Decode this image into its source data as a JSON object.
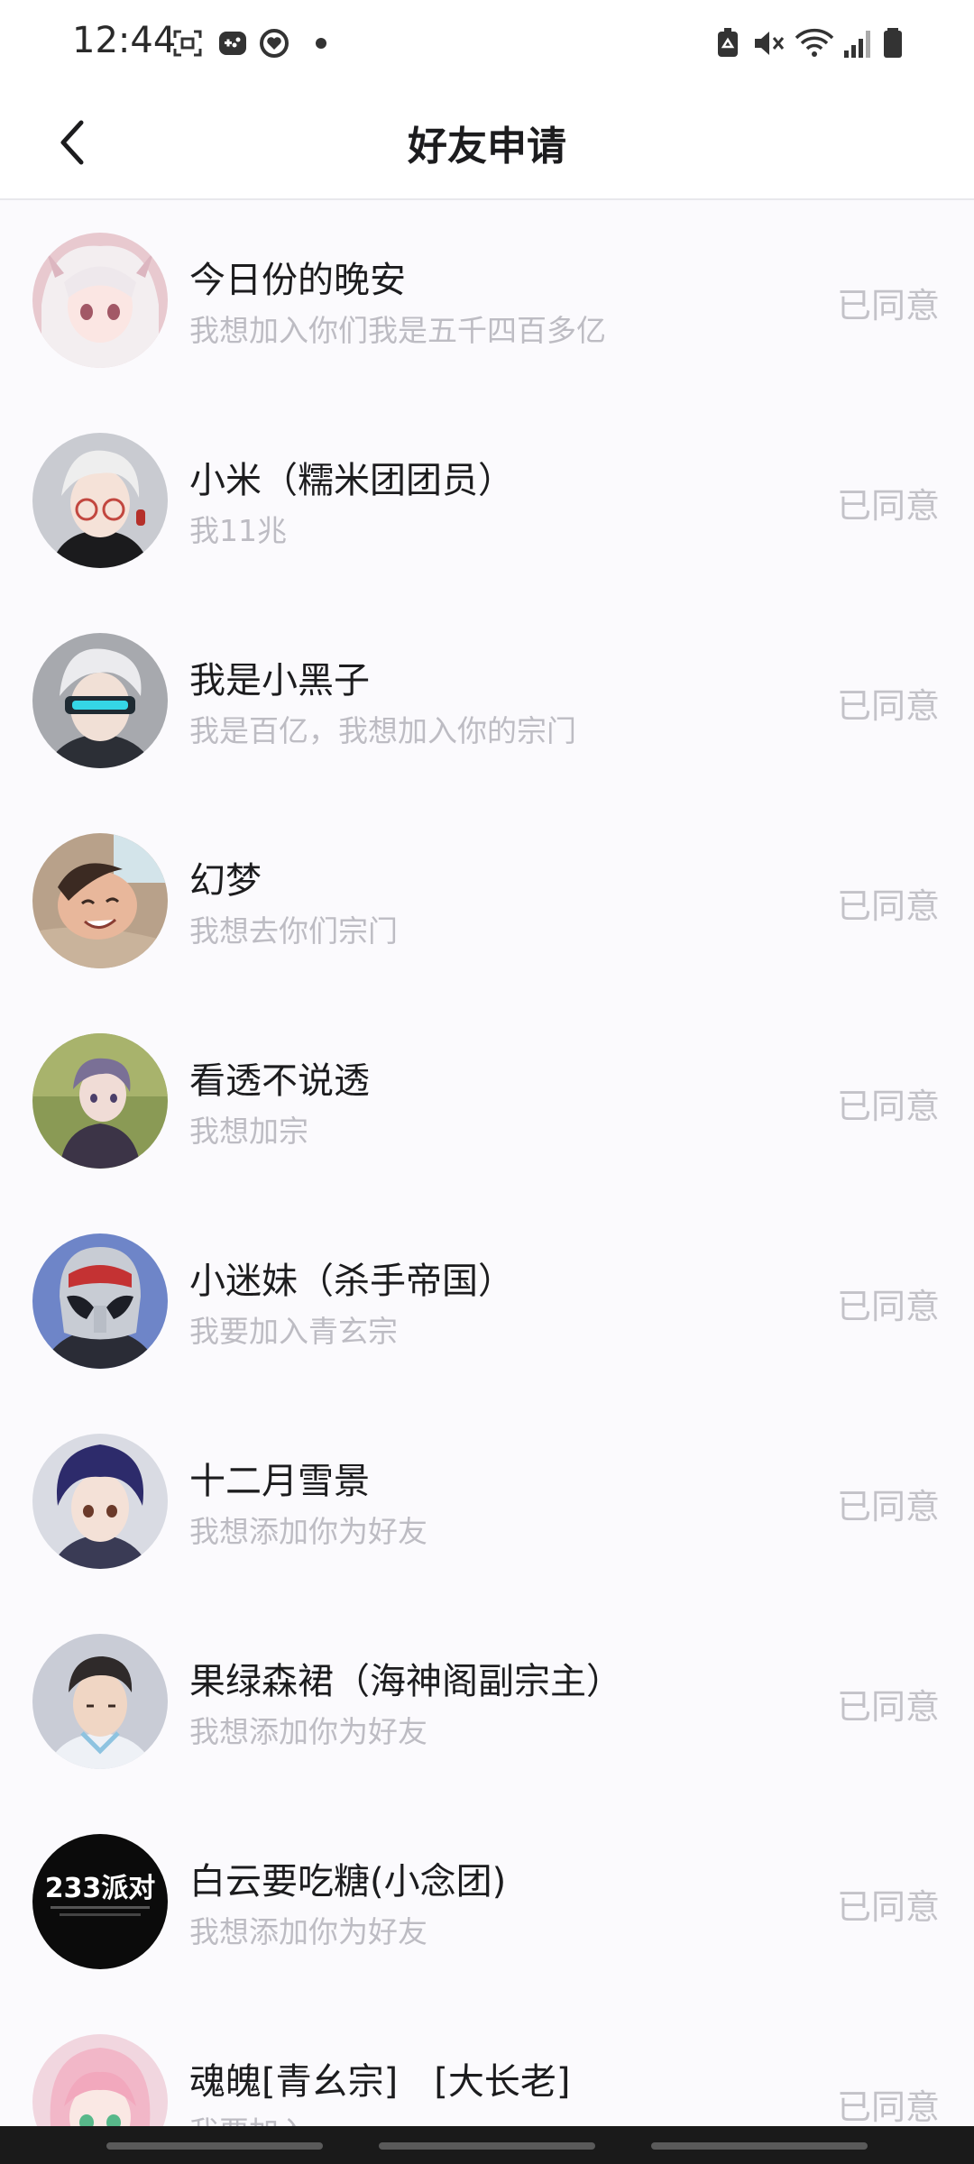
{
  "status_bar": {
    "time": "12:44",
    "left_icons": [
      "screenshot-icon",
      "game-icon",
      "heart-shield-icon",
      "dot-icon"
    ],
    "right_icons": [
      "recycle-battery-icon",
      "mute-icon",
      "wifi-icon",
      "signal-icon",
      "battery-icon"
    ]
  },
  "header": {
    "back_icon": "chevron-left-icon",
    "title": "好友申请"
  },
  "requests": [
    {
      "name": "今日份的晚安",
      "message": "我想加入你们我是五千四百多亿",
      "status": "已同意",
      "avatar": "anime-girl-white-hair"
    },
    {
      "name": "小米（糯米团团员）",
      "message": "我11兆",
      "status": "已同意",
      "avatar": "anime-boy-glasses"
    },
    {
      "name": "我是小黑子",
      "message": "我是百亿，我想加入你的宗门",
      "status": "已同意",
      "avatar": "anime-boy-visor"
    },
    {
      "name": "幻梦",
      "message": "我想去你们宗门",
      "status": "已同意",
      "avatar": "photo-child"
    },
    {
      "name": "看透不说透",
      "message": "我想加宗",
      "status": "已同意",
      "avatar": "anime-boy-grass"
    },
    {
      "name": "小迷妹（杀手帝国）",
      "message": "我要加入青玄宗",
      "status": "已同意",
      "avatar": "helmet-hero"
    },
    {
      "name": "十二月雪景",
      "message": "我想添加你为好友",
      "status": "已同意",
      "avatar": "anime-boy-purple-hair"
    },
    {
      "name": "果绿森裙（海神阁副宗主）",
      "message": "我想添加你为好友",
      "status": "已同意",
      "avatar": "anime-man-dark-hair"
    },
    {
      "name": "白云要吃糖(小念团)",
      "message": "我想添加你为好友",
      "status": "已同意",
      "avatar": "party-poster",
      "avatar_text": "233派对"
    },
    {
      "name": "魂魄[青幺宗]　[大长老]",
      "message": "我要加入",
      "status": "已同意",
      "avatar": "anime-girl-pink-hair"
    }
  ]
}
